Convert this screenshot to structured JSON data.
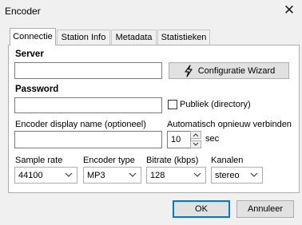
{
  "window": {
    "title": "Encoder"
  },
  "tabs": [
    "Connectie",
    "Station Info",
    "Metadata",
    "Statistieken"
  ],
  "connectie": {
    "server_label": "Server",
    "server_value": "",
    "wizard_button": "Configuratie Wizard",
    "password_label": "Password",
    "password_value": "",
    "public_label": "Publiek (directory)",
    "public_checked": false,
    "display_name_label": "Encoder display name (optioneel)",
    "display_name_value": "",
    "reconnect_label": "Automatisch opnieuw verbinden",
    "reconnect_value": "10",
    "reconnect_unit": "sec",
    "sample_rate_label": "Sample rate",
    "sample_rate_value": "44100",
    "encoder_type_label": "Encoder type",
    "encoder_type_value": "MP3",
    "bitrate_label": "Bitrate (kbps)",
    "bitrate_value": "128",
    "channels_label": "Kanalen",
    "channels_value": "stereo"
  },
  "footer": {
    "ok": "OK",
    "cancel": "Annuleer"
  },
  "colors": {
    "focus_border": "#0078d7",
    "background": "#f0f0f0"
  }
}
